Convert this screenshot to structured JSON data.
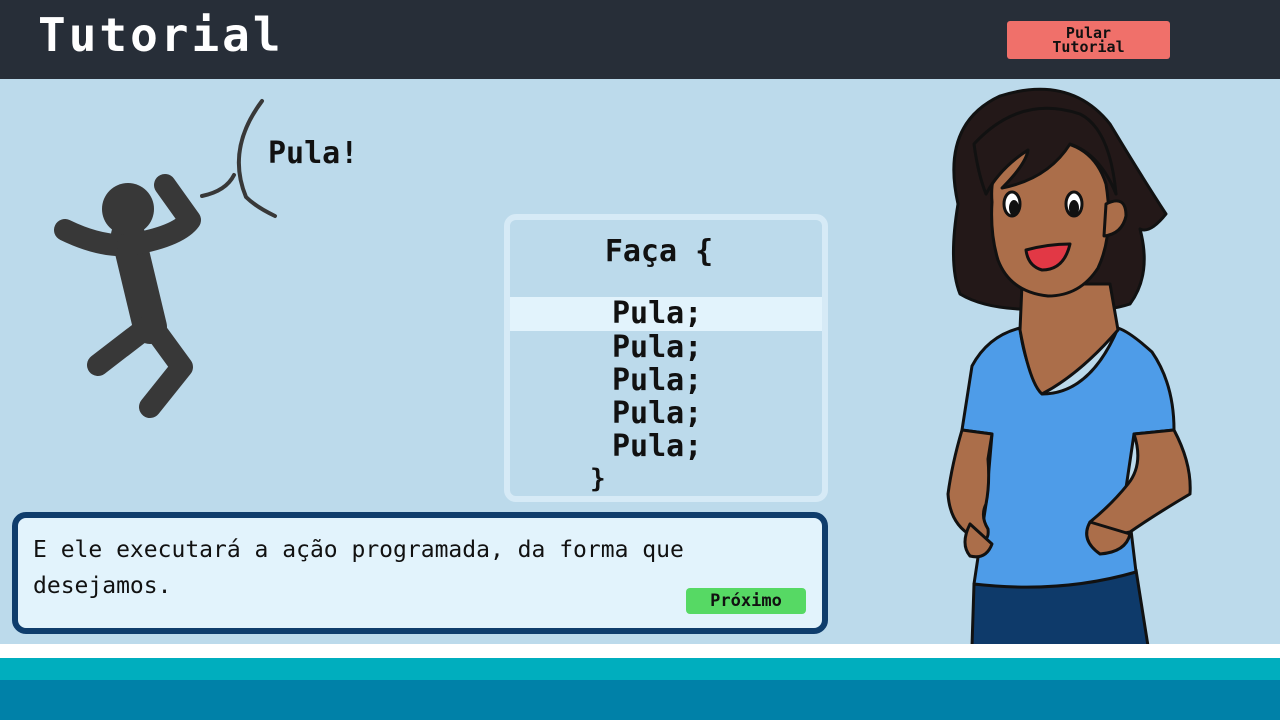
{
  "header": {
    "title": "Tutorial",
    "skip_button_line1": "Pular",
    "skip_button_line2": "Tutorial"
  },
  "scene": {
    "speech_text": "Pula!"
  },
  "code": {
    "header": "Faça {",
    "lines": [
      "Pula;",
      "Pula;",
      "Pula;",
      "Pula;",
      "Pula;"
    ],
    "highlighted_line": 0,
    "closing": "}"
  },
  "dialog": {
    "text": "E ele executará a ação programada, da forma que desejamos.",
    "next_label": "Próximo"
  },
  "colors": {
    "header_bg": "#272e38",
    "scene_bg": "#bcdaeb",
    "skip_button": "#f0706a",
    "next_button": "#56d964",
    "dialog_border": "#0f3d6c",
    "footer_teal": "#00aebe",
    "footer_blue": "#0081a8"
  },
  "icons": {
    "figure": "jumping-stick-figure",
    "character": "teacher-character"
  }
}
